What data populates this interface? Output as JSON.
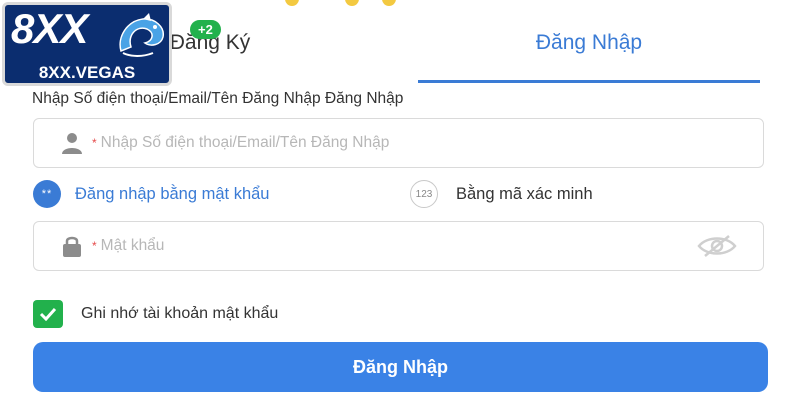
{
  "logo": {
    "mark": "8XX",
    "domain": "8XX.VEGAS",
    "icon": "dragon-emblem"
  },
  "tabs": {
    "register_label": "Đăng Ký",
    "register_badge": "+2",
    "login_label": "Đăng Nhập",
    "active": "login"
  },
  "form": {
    "account_label": "Nhập Số điện thoại/Email/Tên Đăng Nhập Đăng Nhập",
    "account_placeholder": "Nhập Số điện thoại/Email/Tên Đăng Nhập",
    "account_icon": "user-icon",
    "required_mark": "*",
    "method_password_label": "Đăng nhập bằng mật khẩu",
    "method_password_icon": "**",
    "method_code_label": "Bằng mã xác minh",
    "method_code_icon": "123",
    "active_method": "password",
    "password_placeholder": "Mật khẩu",
    "password_icon": "lock-icon",
    "visibility_icon": "eye-off-icon",
    "remember_label": "Ghi nhớ tài khoản mật khẩu",
    "remember_checked": true,
    "submit_label": "Đăng Nhập"
  },
  "colors": {
    "primary": "#3a7bd5",
    "button": "#3a82e6",
    "success": "#22b14c",
    "logo_bg": "#0b2d6f",
    "required": "#e54b4b"
  }
}
